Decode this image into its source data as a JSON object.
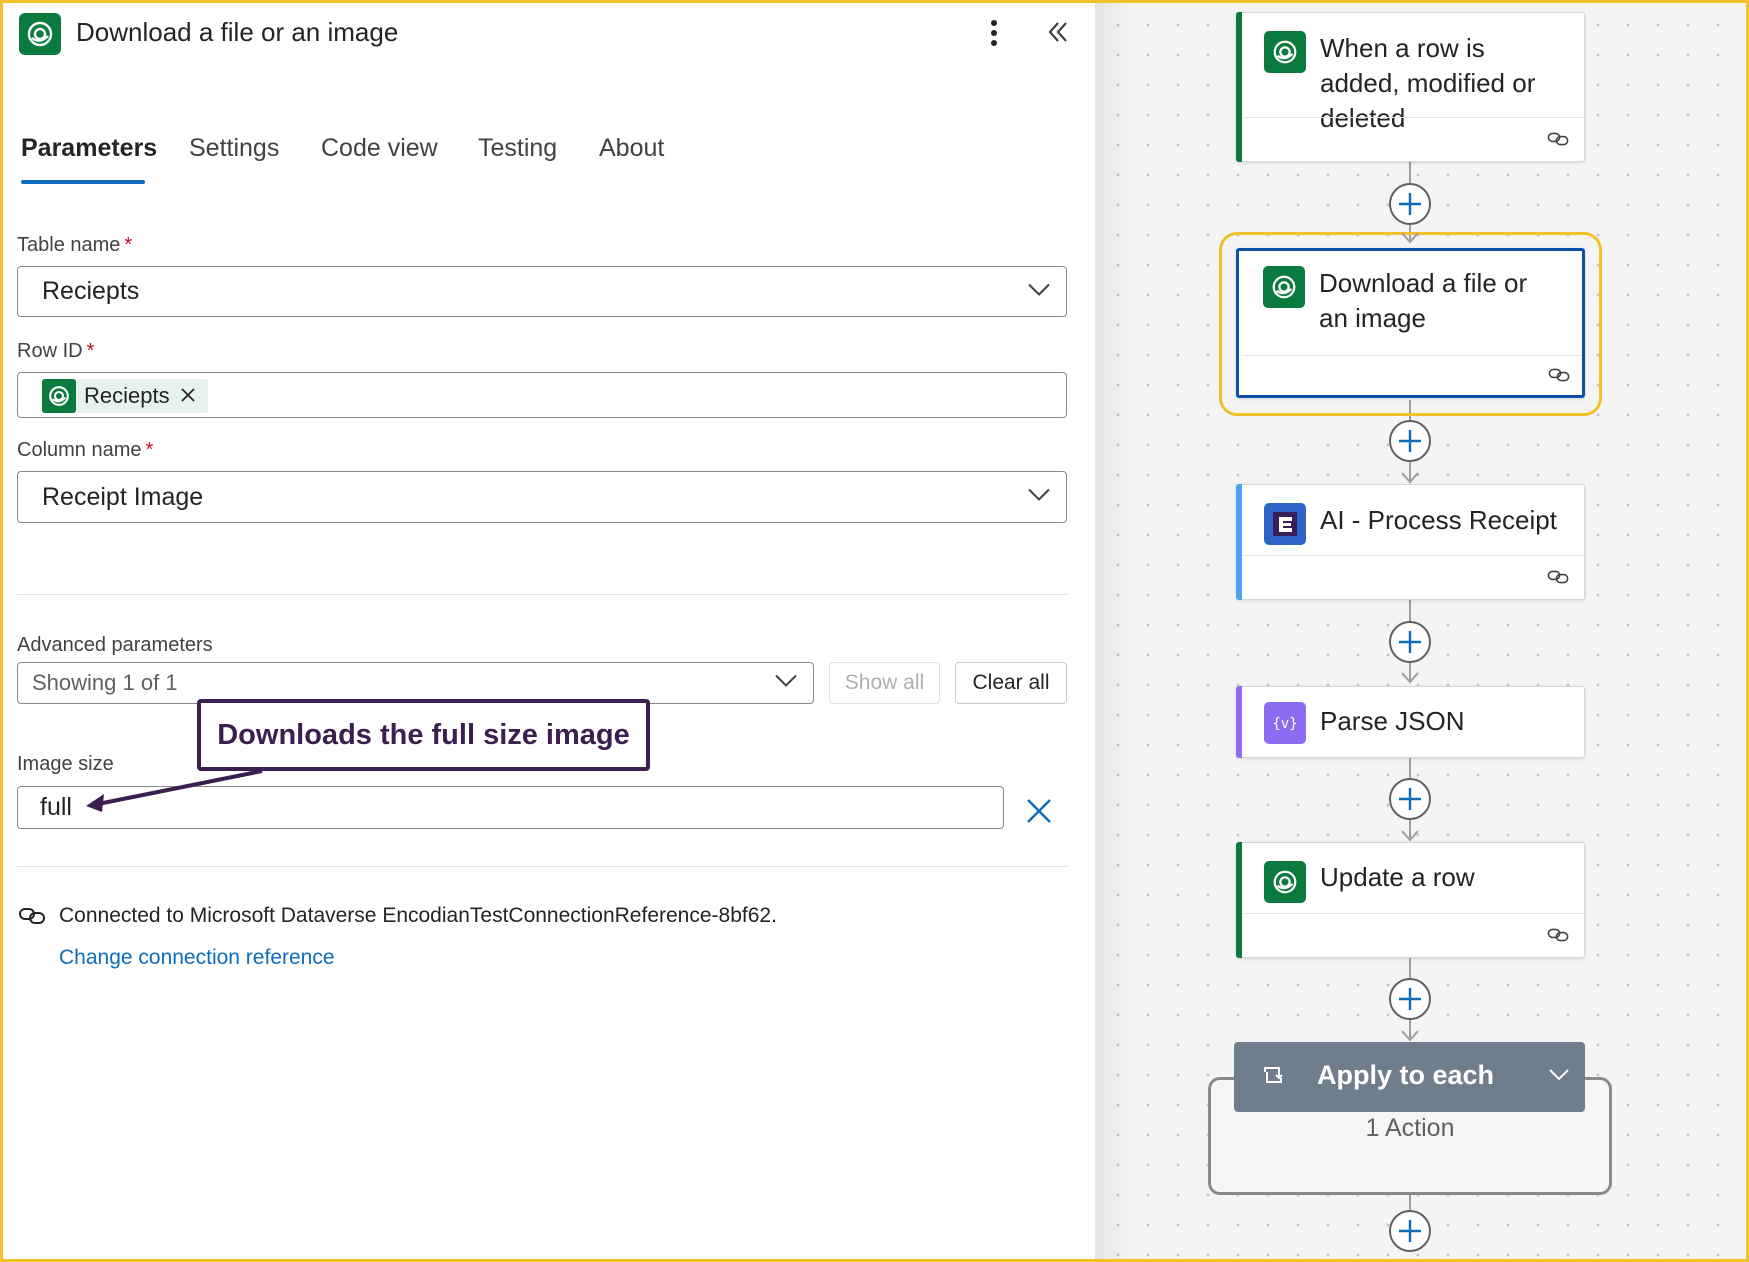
{
  "header": {
    "title": "Download a file or an image"
  },
  "tabs": [
    {
      "label": "Parameters",
      "active": true
    },
    {
      "label": "Settings",
      "active": false
    },
    {
      "label": "Code view",
      "active": false
    },
    {
      "label": "Testing",
      "active": false
    },
    {
      "label": "About",
      "active": false
    }
  ],
  "fields": {
    "table_name": {
      "label": "Table name",
      "required_mark": "*",
      "value": "Reciepts"
    },
    "row_id": {
      "label": "Row ID",
      "required_mark": "*",
      "token_label": "Reciepts"
    },
    "column_name": {
      "label": "Column name",
      "required_mark": "*",
      "value": "Receipt Image"
    }
  },
  "advanced": {
    "label": "Advanced parameters",
    "selected": "Showing 1 of 1",
    "show_all_label": "Show all",
    "clear_all_label": "Clear all"
  },
  "image_size": {
    "label": "Image size",
    "value": "full"
  },
  "callout": {
    "text": "Downloads the full size image"
  },
  "connection": {
    "text": "Connected to Microsoft Dataverse EncodianTestConnectionReference-8bf62.",
    "change_link": "Change connection reference"
  },
  "flow": {
    "steps": [
      {
        "title": "When a row is added, modified or deleted",
        "icon": "dataverse-icon",
        "accent": "#0b7a3e"
      },
      {
        "title": "Download a file or an image",
        "icon": "dataverse-icon",
        "accent": "#0f4ea8",
        "selected": true
      },
      {
        "title": "AI - Process Receipt",
        "icon": "encodian-icon",
        "accent": "#4ba3f0"
      },
      {
        "title": "Parse JSON",
        "icon": "data-operation-icon",
        "accent": "#8c6cf0"
      },
      {
        "title": "Update a row",
        "icon": "dataverse-icon",
        "accent": "#0b7a3e"
      }
    ],
    "loop": {
      "title": "Apply to each",
      "count": "1 Action"
    }
  },
  "colors": {
    "dataverse_green": "#0b7a3e",
    "link_blue": "#0f6cbd",
    "highlight_yellow": "#f2c12e",
    "callout_purple": "#3b1f4f",
    "required_red": "#c50f1f"
  }
}
